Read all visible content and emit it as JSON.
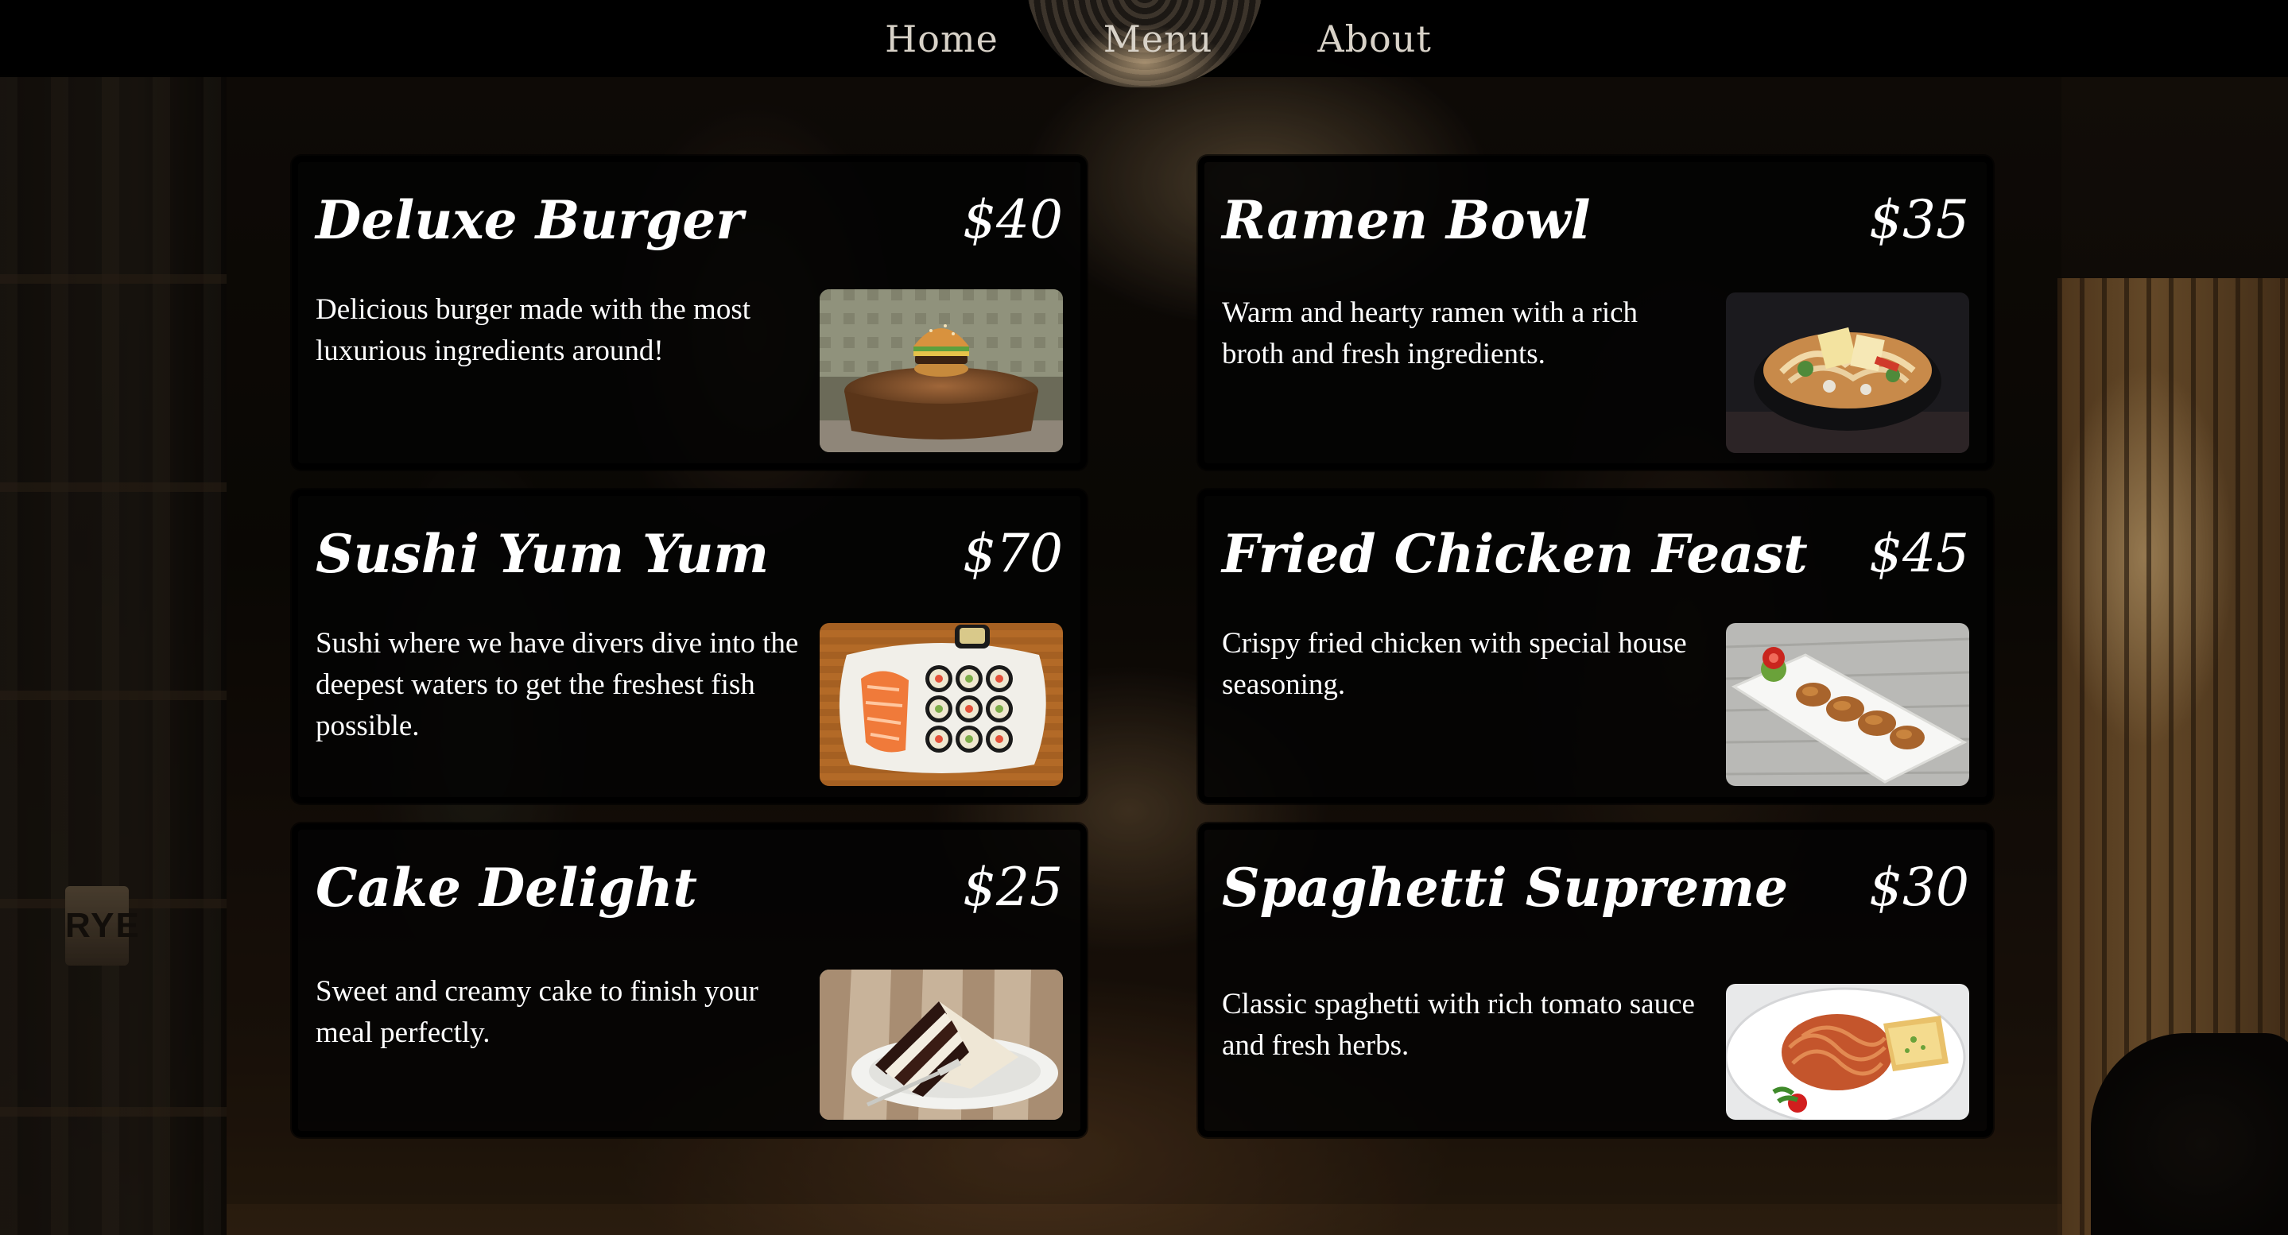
{
  "nav": {
    "links": [
      {
        "label": "Home"
      },
      {
        "label": "Menu"
      },
      {
        "label": "About"
      }
    ]
  },
  "background": {
    "bottle_label": "RYE"
  },
  "menu": {
    "items": [
      {
        "name": "Deluxe Burger",
        "price": "$40",
        "description": "Delicious burger made with the most luxurious ingredients around!",
        "image": "burger-on-wood-slab-image"
      },
      {
        "name": "Ramen Bowl",
        "price": "$35",
        "description": "Warm and hearty ramen with a rich broth and fresh ingredients.",
        "image": "ramen-bowl-image"
      },
      {
        "name": "Sushi Yum Yum",
        "price": "$70",
        "description": "Sushi where we have divers dive into the deepest waters to get the freshest fish possible.",
        "image": "sushi-plate-image"
      },
      {
        "name": "Fried Chicken Feast",
        "price": "$45",
        "description": "Crispy fried chicken with special house seasoning.",
        "image": "fried-chicken-platter-image"
      },
      {
        "name": "Cake Delight",
        "price": "$25",
        "description": "Sweet and creamy cake to finish your meal perfectly.",
        "image": "chocolate-cake-slice-image"
      },
      {
        "name": "Spaghetti Supreme",
        "price": "$30",
        "description": "Classic spaghetti with rich tomato sauce and fresh herbs.",
        "image": "spaghetti-plate-image"
      }
    ]
  },
  "colors": {
    "text": "#ffffff",
    "nav_text": "#d8d2c8",
    "nav_bg": "#000000",
    "card_bg": "#030303"
  }
}
